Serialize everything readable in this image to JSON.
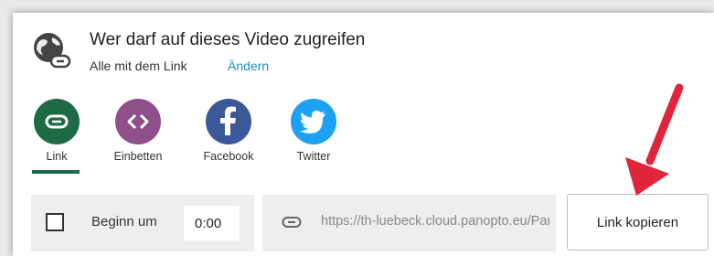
{
  "header": {
    "title": "Wer darf auf dieses Video zugreifen",
    "access_scope": "Alle mit dem Link",
    "change_label": "Ändern",
    "icon": "globe-link-icon"
  },
  "share_options": [
    {
      "label": "Link",
      "icon": "link-icon",
      "color": "#1e6a45",
      "selected": true
    },
    {
      "label": "Einbetten",
      "icon": "code-icon",
      "color": "#8e4f8a",
      "selected": false
    },
    {
      "label": "Facebook",
      "icon": "facebook-icon",
      "color": "#3b5998",
      "selected": false
    },
    {
      "label": "Twitter",
      "icon": "twitter-icon",
      "color": "#1da1f2",
      "selected": false
    }
  ],
  "start_at": {
    "label": "Beginn um",
    "time": "0:00",
    "checked": false
  },
  "link": {
    "url": "https://th-luebeck.cloud.panopto.eu/Panopto/Pages/Viewer.aspx",
    "icon": "link-icon"
  },
  "copy_button_label": "Link kopieren",
  "annotation": {
    "type": "red-arrow",
    "color": "#e0243a"
  }
}
